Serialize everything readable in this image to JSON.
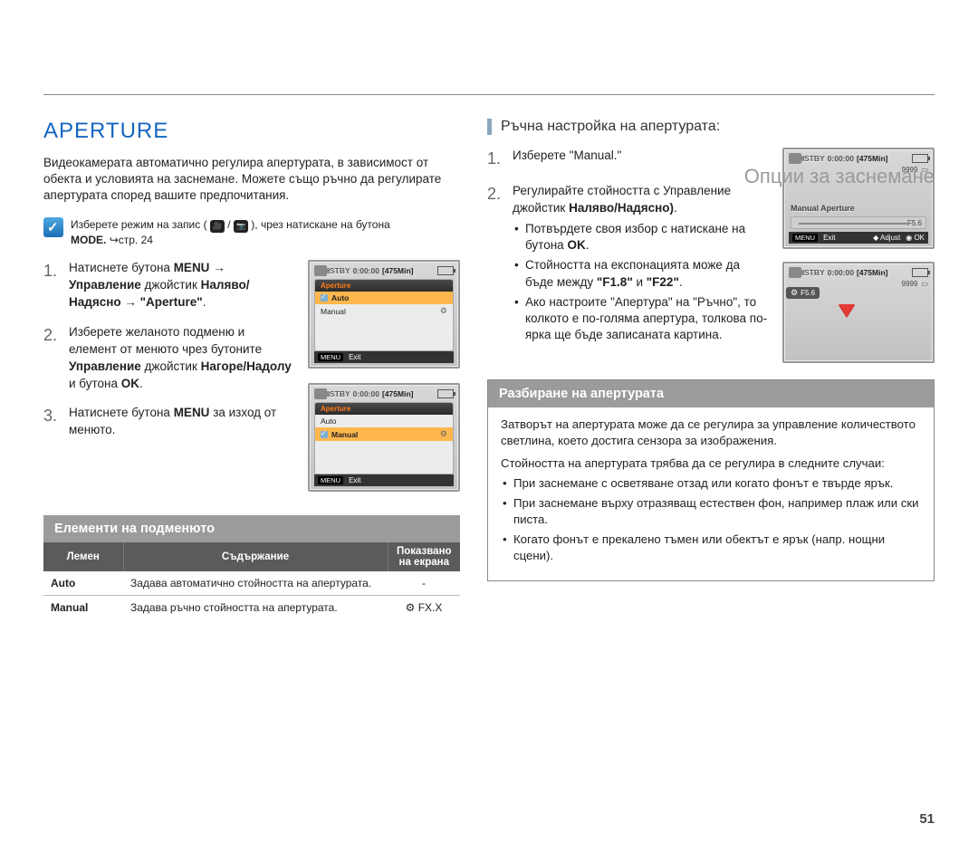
{
  "breadcrumb": "Опции за заснемане",
  "page_number": "51",
  "left": {
    "title": "APERTURE",
    "intro": "Видеокамерата автоматично регулира апертурата, в зависимост от обекта и условията на заснемане. Можете също ръчно да регулирате апертурата според вашите предпочитания.",
    "note_prefix": "Изберете режим на запис (",
    "note_suffix": " ), чрез натискане на бутона",
    "note_mode": "MODE.",
    "note_page_ref": "стр. 24",
    "step1_a": "Натиснете бутона ",
    "step1_menu": "MENU",
    "step1_arrow": " → ",
    "step1_ctrl": "Управление",
    "step1_b": " джойстик ",
    "step1_dir": "Наляво/Надясно",
    "step1_c": " → ",
    "step1_ap": "\"Aperture\"",
    "step1_dot": ".",
    "step2_a": "Изберете желаното подменю и елемент от менюто чрез бутоните ",
    "step2_ctrl": "Управление",
    "step2_b": " джойстик ",
    "step2_dir": "Нагоре/Надолу",
    "step2_c": " и бутона ",
    "step2_ok": "OK",
    "step2_dot": ".",
    "step3_a": "Натиснете бутона ",
    "step3_menu": "MENU",
    "step3_b": " за изход от менюто.",
    "submenu_title": "Елементи на подменюто",
    "table": {
      "h1": "Лемен",
      "h2": "Съдържание",
      "h3_a": "Показвано",
      "h3_b": "на екрана",
      "r1c1": "Auto",
      "r1c2": "Задава автоматично стойността на апертурата.",
      "r1c3": "-",
      "r2c1": "Manual",
      "r2c2": "Задава ръчно стойността на апертурата.",
      "r2c3": "FX.X"
    },
    "lcd": {
      "stby": "STBY",
      "time": "0:00:00",
      "remain": "[475Min]",
      "tab": "Aperture",
      "auto": "Auto",
      "manual": "Manual",
      "menu": "MENU",
      "exit": "Exit",
      "count": "9999"
    }
  },
  "right": {
    "heading": "Ръчна настройка на апертурата:",
    "step1": "Изберете \"Manual.\"",
    "step2_a": "Регулирайте стойността с Управление джойстик ",
    "step2_dir": "Наляво/Надясно)",
    "step2_dot": ".",
    "b1_a": "Потвърдете своя избор с натискане на бутона ",
    "b1_ok": "OK",
    "b1_dot": ".",
    "b2_a": "Стойността на експонацията може да бъде между ",
    "b2_range1": "\"F1.8\"",
    "b2_and": " и ",
    "b2_range2": "\"F22\"",
    "b2_dot": ".",
    "b3": "Ако настроите \"Апертура\" на \"Ръчно\", то колкото е по-голяма апертура, толкова по-ярка ще бъде записаната картина.",
    "lcd": {
      "manual": "Manual Aperture",
      "fval": "F5.6",
      "adjust": "Adjust",
      "ok": "OK",
      "exit": "Exit",
      "menu": "MENU"
    },
    "info": {
      "title": "Разбиране на апертурата",
      "p1": "Затворът на апертурата може да се регулира за управление количеството светлина, което достига сензора за изображения.",
      "p2": "Стойността на апертурата трябва да се регулира в следните случаи:",
      "li1": "При заснемане с осветяване отзад или когато фонът е твърде ярък.",
      "li2": "При заснемане върху отразяващ естествен фон, например плаж или ски писта.",
      "li3": "Когато фонът е прекалено тъмен или обектът е ярък (напр. нощни сцени)."
    }
  }
}
